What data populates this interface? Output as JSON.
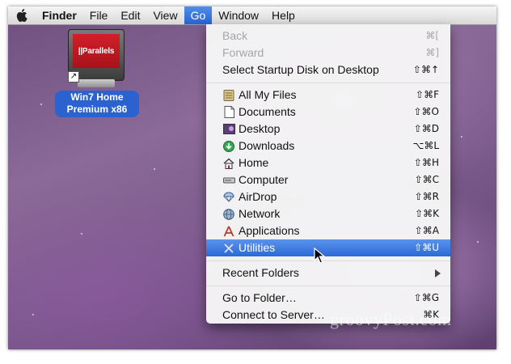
{
  "menubar": {
    "apple_icon": "apple-icon",
    "items": [
      {
        "label": "Finder",
        "bold": true
      },
      {
        "label": "File"
      },
      {
        "label": "Edit"
      },
      {
        "label": "View"
      },
      {
        "label": "Go",
        "active": true
      },
      {
        "label": "Window"
      },
      {
        "label": "Help"
      }
    ]
  },
  "desktop": {
    "icon": {
      "screen_text": "||Parallels",
      "label_line1": "Win7 Home",
      "label_line2": "Premium x86",
      "alias_badge": "alias-arrow-icon"
    }
  },
  "go_menu": {
    "items": [
      {
        "label": "Back",
        "shortcut": "⌘[",
        "disabled": true
      },
      {
        "label": "Forward",
        "shortcut": "⌘]",
        "disabled": true
      },
      {
        "label": "Select Startup Disk on Desktop",
        "shortcut": "⇧⌘↑"
      },
      {
        "label": "All My Files",
        "shortcut": "⇧⌘F",
        "icon": "all-my-files-icon"
      },
      {
        "label": "Documents",
        "shortcut": "⇧⌘O",
        "icon": "documents-icon"
      },
      {
        "label": "Desktop",
        "shortcut": "⇧⌘D",
        "icon": "desktop-icon"
      },
      {
        "label": "Downloads",
        "shortcut": "⌥⌘L",
        "icon": "downloads-icon"
      },
      {
        "label": "Home",
        "shortcut": "⇧⌘H",
        "icon": "home-icon"
      },
      {
        "label": "Computer",
        "shortcut": "⇧⌘C",
        "icon": "computer-icon"
      },
      {
        "label": "AirDrop",
        "shortcut": "⇧⌘R",
        "icon": "airdrop-icon"
      },
      {
        "label": "Network",
        "shortcut": "⇧⌘K",
        "icon": "network-icon"
      },
      {
        "label": "Applications",
        "shortcut": "⇧⌘A",
        "icon": "applications-icon"
      },
      {
        "label": "Utilities",
        "shortcut": "⇧⌘U",
        "icon": "utilities-icon",
        "selected": true
      },
      {
        "label": "Recent Folders",
        "submenu": true
      },
      {
        "label": "Go to Folder…",
        "shortcut": "⇧⌘G"
      },
      {
        "label": "Connect to Server…",
        "shortcut": "⌘K"
      }
    ]
  },
  "watermark": "groovyPost.com",
  "colors": {
    "selection": "#2e68d6",
    "label_highlight": "#2a63cf",
    "disabled_text": "#a6a6a6"
  }
}
